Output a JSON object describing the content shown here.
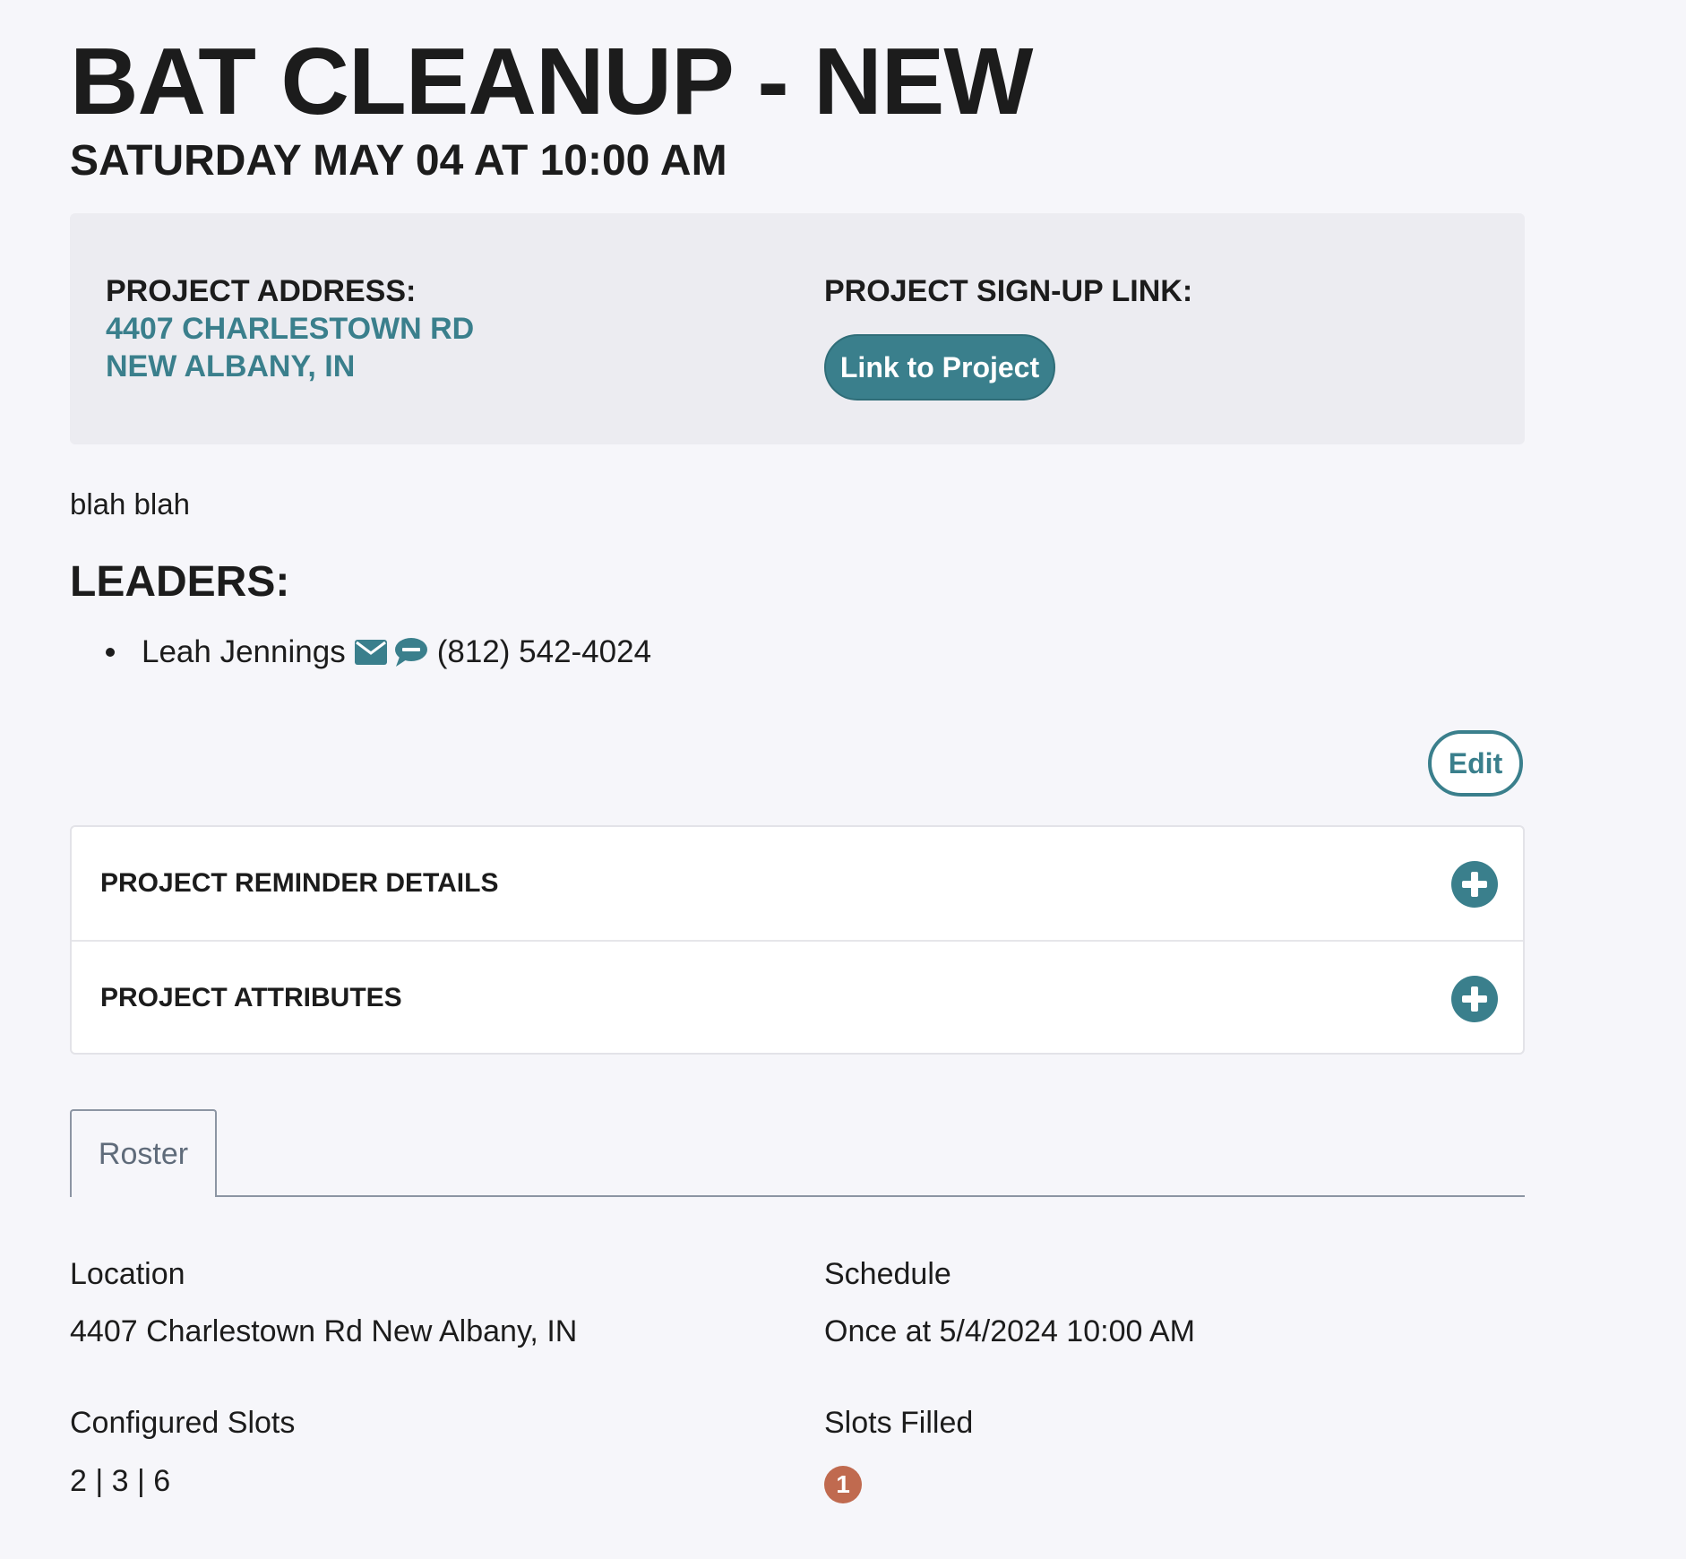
{
  "page": {
    "title": "BAT CLEANUP - NEW",
    "subtitle": "SATURDAY MAY 04 AT 10:00 AM"
  },
  "info": {
    "address_label": "PROJECT ADDRESS:",
    "address_line1": "4407 CHARLESTOWN RD",
    "address_line2": "NEW ALBANY, IN",
    "signup_label": "PROJECT SIGN-UP LINK:",
    "signup_button": "Link to Project"
  },
  "description": "blah blah",
  "leaders": {
    "heading": "LEADERS:",
    "items": [
      {
        "name": "Leah Jennings",
        "phone": "(812) 542-4024",
        "icons": [
          "envelope-icon",
          "sms-icon"
        ]
      }
    ]
  },
  "edit_button": "Edit",
  "accordion": [
    {
      "title": "PROJECT REMINDER DETAILS",
      "icon": "plus-circle-icon"
    },
    {
      "title": "PROJECT ATTRIBUTES",
      "icon": "plus-circle-icon"
    }
  ],
  "tabs": [
    {
      "label": "Roster",
      "active": true
    }
  ],
  "details": {
    "location_label": "Location",
    "location_value": "4407 Charlestown Rd New Albany, IN",
    "schedule_label": "Schedule",
    "schedule_value": "Once at 5/4/2024 10:00 AM",
    "slots_label": "Configured Slots",
    "slots_value": "2 | 3 | 6",
    "filled_label": "Slots Filled",
    "filled_count": "1"
  },
  "colors": {
    "accent": "#3a7f8c",
    "badge": "#c06a4f",
    "background": "#f6f6fa",
    "info_box": "#ececf1"
  }
}
